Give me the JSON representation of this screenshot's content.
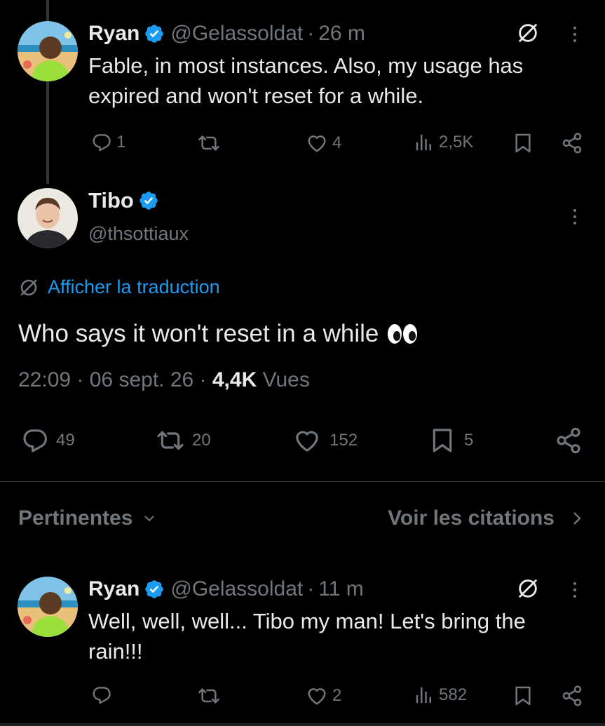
{
  "reply1": {
    "name": "Ryan",
    "handle": "@Gelassoldat",
    "time": "26 m",
    "text": "Fable, in most instances. Also, my usage has expired and won't reset for a while.",
    "replies": "1",
    "likes": "4",
    "views": "2,5K"
  },
  "main": {
    "name": "Tibo",
    "handle": "@thsottiaux",
    "translate": "Afficher la traduction",
    "text": "Who says it won't reset in a while",
    "time": "22:09",
    "date": "06 sept. 26",
    "views_count": "4,4K",
    "views_label": "Vues",
    "replies": "49",
    "reposts": "20",
    "likes": "152",
    "bookmarks": "5"
  },
  "sort": {
    "label": "Pertinentes",
    "quotes_link": "Voir les citations"
  },
  "reply2": {
    "name": "Ryan",
    "handle": "@Gelassoldat",
    "time": "11 m",
    "text": "Well, well, well... Tibo my man! Let's bring the rain!!!",
    "likes": "2",
    "views": "582"
  },
  "colors": {
    "background": "#000000",
    "text": "#e7e9ea",
    "muted": "#71767b",
    "link": "#1d9bf0",
    "verified": "#1d9bf0"
  },
  "icons": [
    "reply-icon",
    "repost-icon",
    "like-icon",
    "views-icon",
    "bookmark-icon",
    "share-icon",
    "translate-icon",
    "verified-badge-icon",
    "more-icon",
    "chevron-down-icon",
    "chevron-right-icon",
    "eyes-emoji"
  ]
}
